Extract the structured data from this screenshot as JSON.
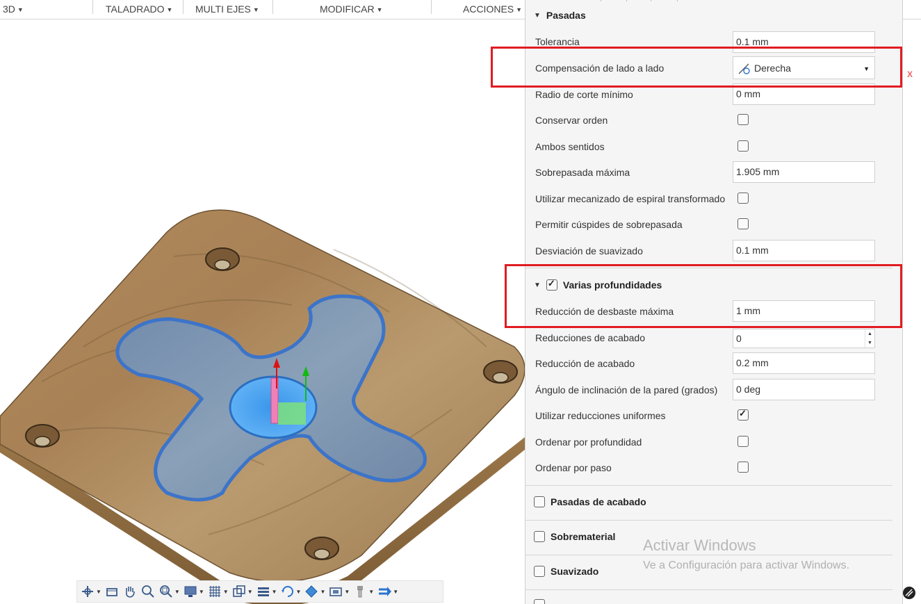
{
  "toolbar": {
    "items": [
      {
        "label": "3D"
      },
      {
        "label": "TALADRADO"
      },
      {
        "label": "MULTI EJES"
      },
      {
        "label": "MODIFICAR"
      },
      {
        "label": "ACCIONES"
      }
    ]
  },
  "panel": {
    "section_pasadas": {
      "title": "Pasadas",
      "tolerancia_label": "Tolerancia",
      "tolerancia_value": "0.1 mm",
      "compensacion_label": "Compensación de lado a lado",
      "compensacion_value": "Derecha",
      "radio_label": "Radio de corte mínimo",
      "radio_value": "0 mm",
      "conservar_label": "Conservar orden",
      "conservar_checked": false,
      "ambos_label": "Ambos sentidos",
      "ambos_checked": false,
      "sobrepasada_label": "Sobrepasada máxima",
      "sobrepasada_value": "1.905 mm",
      "espiral_label": "Utilizar mecanizado de espiral transformado",
      "espiral_checked": false,
      "cuspides_label": "Permitir cúspides de sobrepasada",
      "cuspides_checked": false,
      "desviacion_label": "Desviación de suavizado",
      "desviacion_value": "0.1 mm"
    },
    "section_profundidades": {
      "title": "Varias profundidades",
      "checked": true,
      "desbaste_label": "Reducción de desbaste máxima",
      "desbaste_value": "1 mm",
      "reducciones_acabado_label": "Reducciones de acabado",
      "reducciones_acabado_value": "0",
      "reduccion_acabado_label": "Reducción de acabado",
      "reduccion_acabado_value": "0.2 mm",
      "angulo_label": "Ángulo de inclinación de la pared (grados)",
      "angulo_value": "0 deg",
      "uniformes_label": "Utilizar reducciones uniformes",
      "uniformes_checked": true,
      "ordenar_prof_label": "Ordenar por profundidad",
      "ordenar_prof_checked": false,
      "ordenar_paso_label": "Ordenar por paso",
      "ordenar_paso_checked": false
    },
    "collapsed_sections": [
      {
        "title": "Pasadas de acabado",
        "checked": false
      },
      {
        "title": "Sobrematerial",
        "checked": false
      },
      {
        "title": "Suavizado",
        "checked": false
      }
    ]
  },
  "watermark": {
    "title": "Activar Windows",
    "subtitle": "Ve a Configuración para activar Windows."
  },
  "axis_label": "X",
  "colors": {
    "highlight": "#e11b22",
    "wood": "#a8845a",
    "pocket": "#7b93b0",
    "pocket_edge": "#3c74c9",
    "hole_blue": "#4aa3f0"
  },
  "navbar": {
    "icons": [
      "orbit-icon",
      "look-at-icon",
      "pan-icon",
      "zoom-icon",
      "fit-icon",
      "display-settings-icon",
      "grid-icon",
      "viewports-icon",
      "layers-icon",
      "rotate-icon",
      "material-icon",
      "simulation-icon",
      "tool-icon",
      "flow-icon"
    ]
  }
}
